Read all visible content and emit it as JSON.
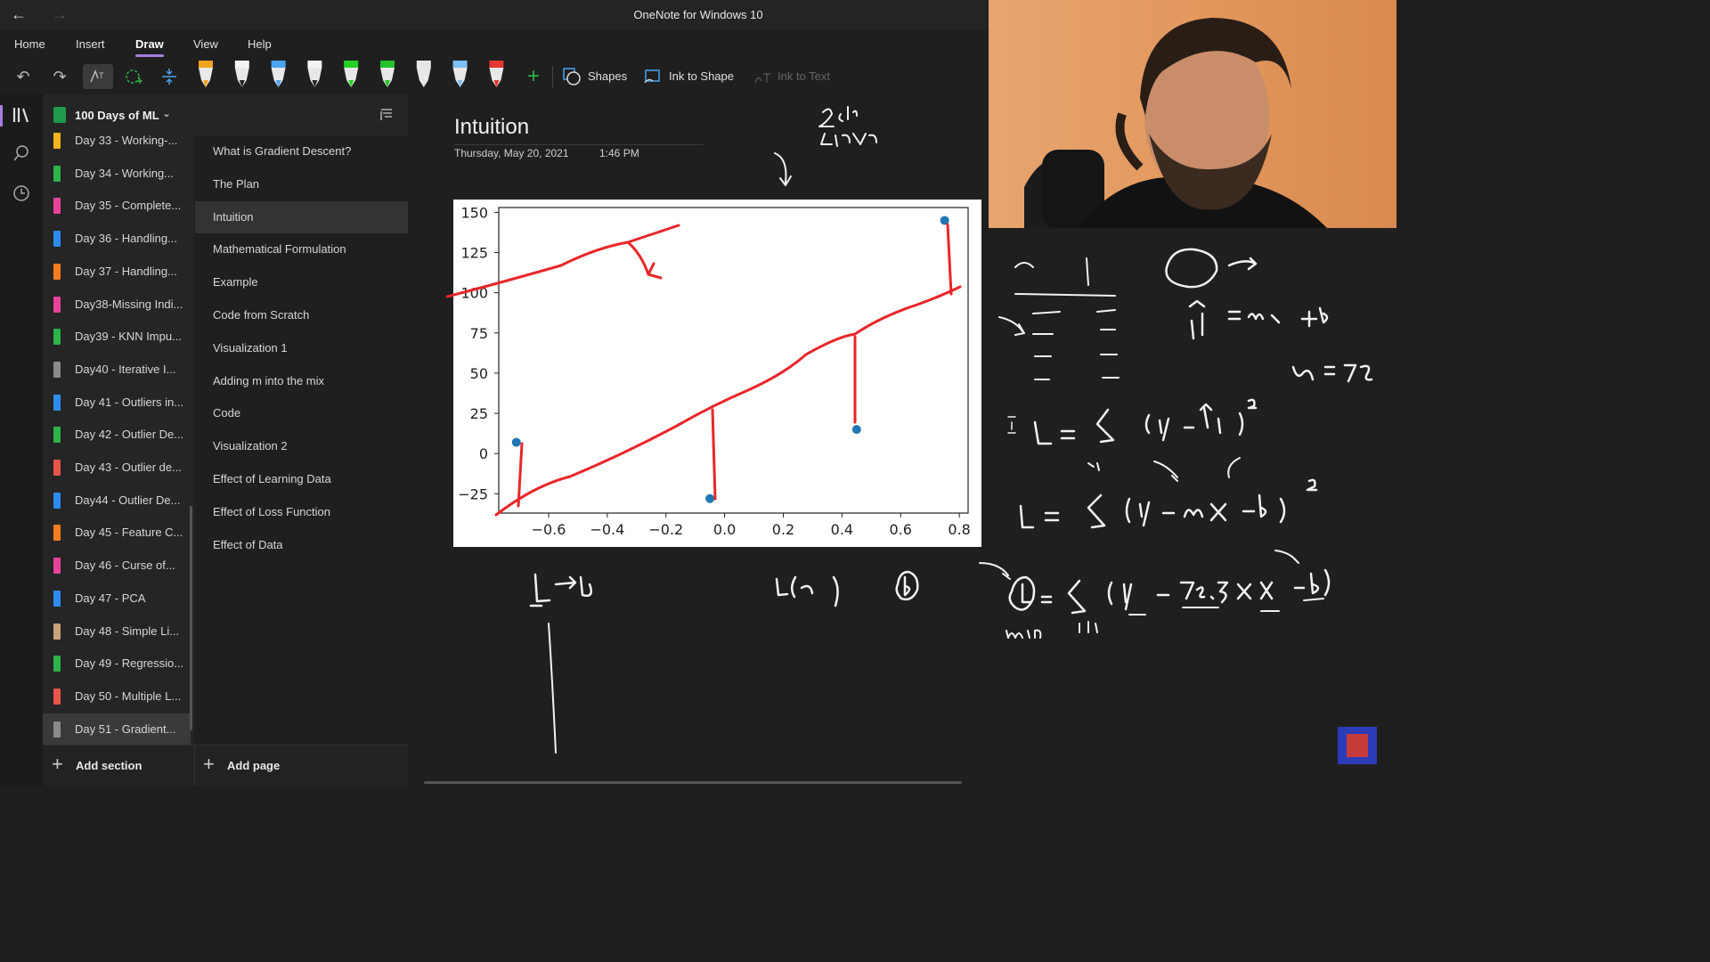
{
  "window": {
    "title": "OneNote for Windows 10"
  },
  "menu": [
    "Home",
    "Insert",
    "Draw",
    "View",
    "Help"
  ],
  "toolbar": {
    "shapes_label": "Shapes",
    "ink_to_shape_label": "Ink to Shape",
    "ink_to_text_label": "Ink to Text",
    "pen_colors": [
      "#f2a31d",
      "#f4f4f4",
      "#4aa3f0",
      "#f4f4f4",
      "#25d125",
      "#25c22a",
      "#e6e6e6",
      "#7fbff2",
      "#e3362f"
    ],
    "add_pen_symbol": "+"
  },
  "notebook": {
    "name": "100 Days of ML"
  },
  "sections": [
    {
      "label": "Day 33 - Working-...",
      "color": "#f2b51c"
    },
    {
      "label": "Day 34 - Working...",
      "color": "#2cb34a"
    },
    {
      "label": "Day 35 - Complete...",
      "color": "#e8439b"
    },
    {
      "label": "Day 36 - Handling...",
      "color": "#2d8cf0"
    },
    {
      "label": "Day 37 - Handling...",
      "color": "#f57c1f"
    },
    {
      "label": "Day38-Missing Indi...",
      "color": "#e8439b"
    },
    {
      "label": "Day39 - KNN Impu...",
      "color": "#2cb34a"
    },
    {
      "label": "Day40 - Iterative I...",
      "color": "#8a8a8a"
    },
    {
      "label": "Day 41 - Outliers in...",
      "color": "#2d8cf0"
    },
    {
      "label": "Day 42 - Outlier De...",
      "color": "#2cb34a"
    },
    {
      "label": "Day 43 - Outlier de...",
      "color": "#e8554a"
    },
    {
      "label": "Day44 - Outlier De...",
      "color": "#2d8cf0"
    },
    {
      "label": "Day 45 - Feature C...",
      "color": "#f57c1f"
    },
    {
      "label": "Day 46 - Curse of...",
      "color": "#e8439b"
    },
    {
      "label": "Day 47 - PCA",
      "color": "#2d8cf0"
    },
    {
      "label": "Day 48 - Simple Li...",
      "color": "#c9a27a"
    },
    {
      "label": "Day 49 - Regressio...",
      "color": "#2cb34a"
    },
    {
      "label": "Day 50 - Multiple L...",
      "color": "#e8554a"
    },
    {
      "label": "Day 51 - Gradient...",
      "color": "#8a8a8a",
      "selected": true
    }
  ],
  "pages": [
    {
      "label": "What is Gradient Descent?"
    },
    {
      "label": "The Plan"
    },
    {
      "label": "Intuition",
      "selected": true
    },
    {
      "label": "Mathematical Formulation"
    },
    {
      "label": "Example"
    },
    {
      "label": "Code from Scratch"
    },
    {
      "label": "Visualization 1"
    },
    {
      "label": "Adding m into the mix"
    },
    {
      "label": "Code"
    },
    {
      "label": "Visualization 2"
    },
    {
      "label": "Effect of Learning Data"
    },
    {
      "label": "Effect of Loss Function"
    },
    {
      "label": "Effect of Data"
    }
  ],
  "footer": {
    "add_section": "Add section",
    "add_page": "Add page"
  },
  "page": {
    "title": "Intuition",
    "date": "Thursday, May 20, 2021",
    "time": "1:46 PM"
  },
  "chart_data": {
    "type": "scatter",
    "x": [
      -0.71,
      -0.05,
      0.45,
      0.75
    ],
    "y": [
      7,
      -28,
      15,
      145
    ],
    "xlim": [
      -0.77,
      0.83
    ],
    "ylim": [
      -37,
      153
    ],
    "xticks": [
      -0.6,
      -0.4,
      -0.2,
      0.0,
      0.2,
      0.4,
      0.6,
      0.8
    ],
    "xtick_labels": [
      "−0.6",
      "−0.4",
      "−0.2",
      "0.0",
      "0.2",
      "0.4",
      "0.6",
      "0.8"
    ],
    "yticks": [
      -25,
      0,
      25,
      50,
      75,
      100,
      125,
      150
    ],
    "ytick_labels": [
      "−25",
      "0",
      "25",
      "50",
      "75",
      "100",
      "125",
      "150"
    ],
    "point_color": "#1f77b4",
    "grid": false
  },
  "ink_color_red": "#e8262a",
  "ink_color_white": "#f2f2f2"
}
